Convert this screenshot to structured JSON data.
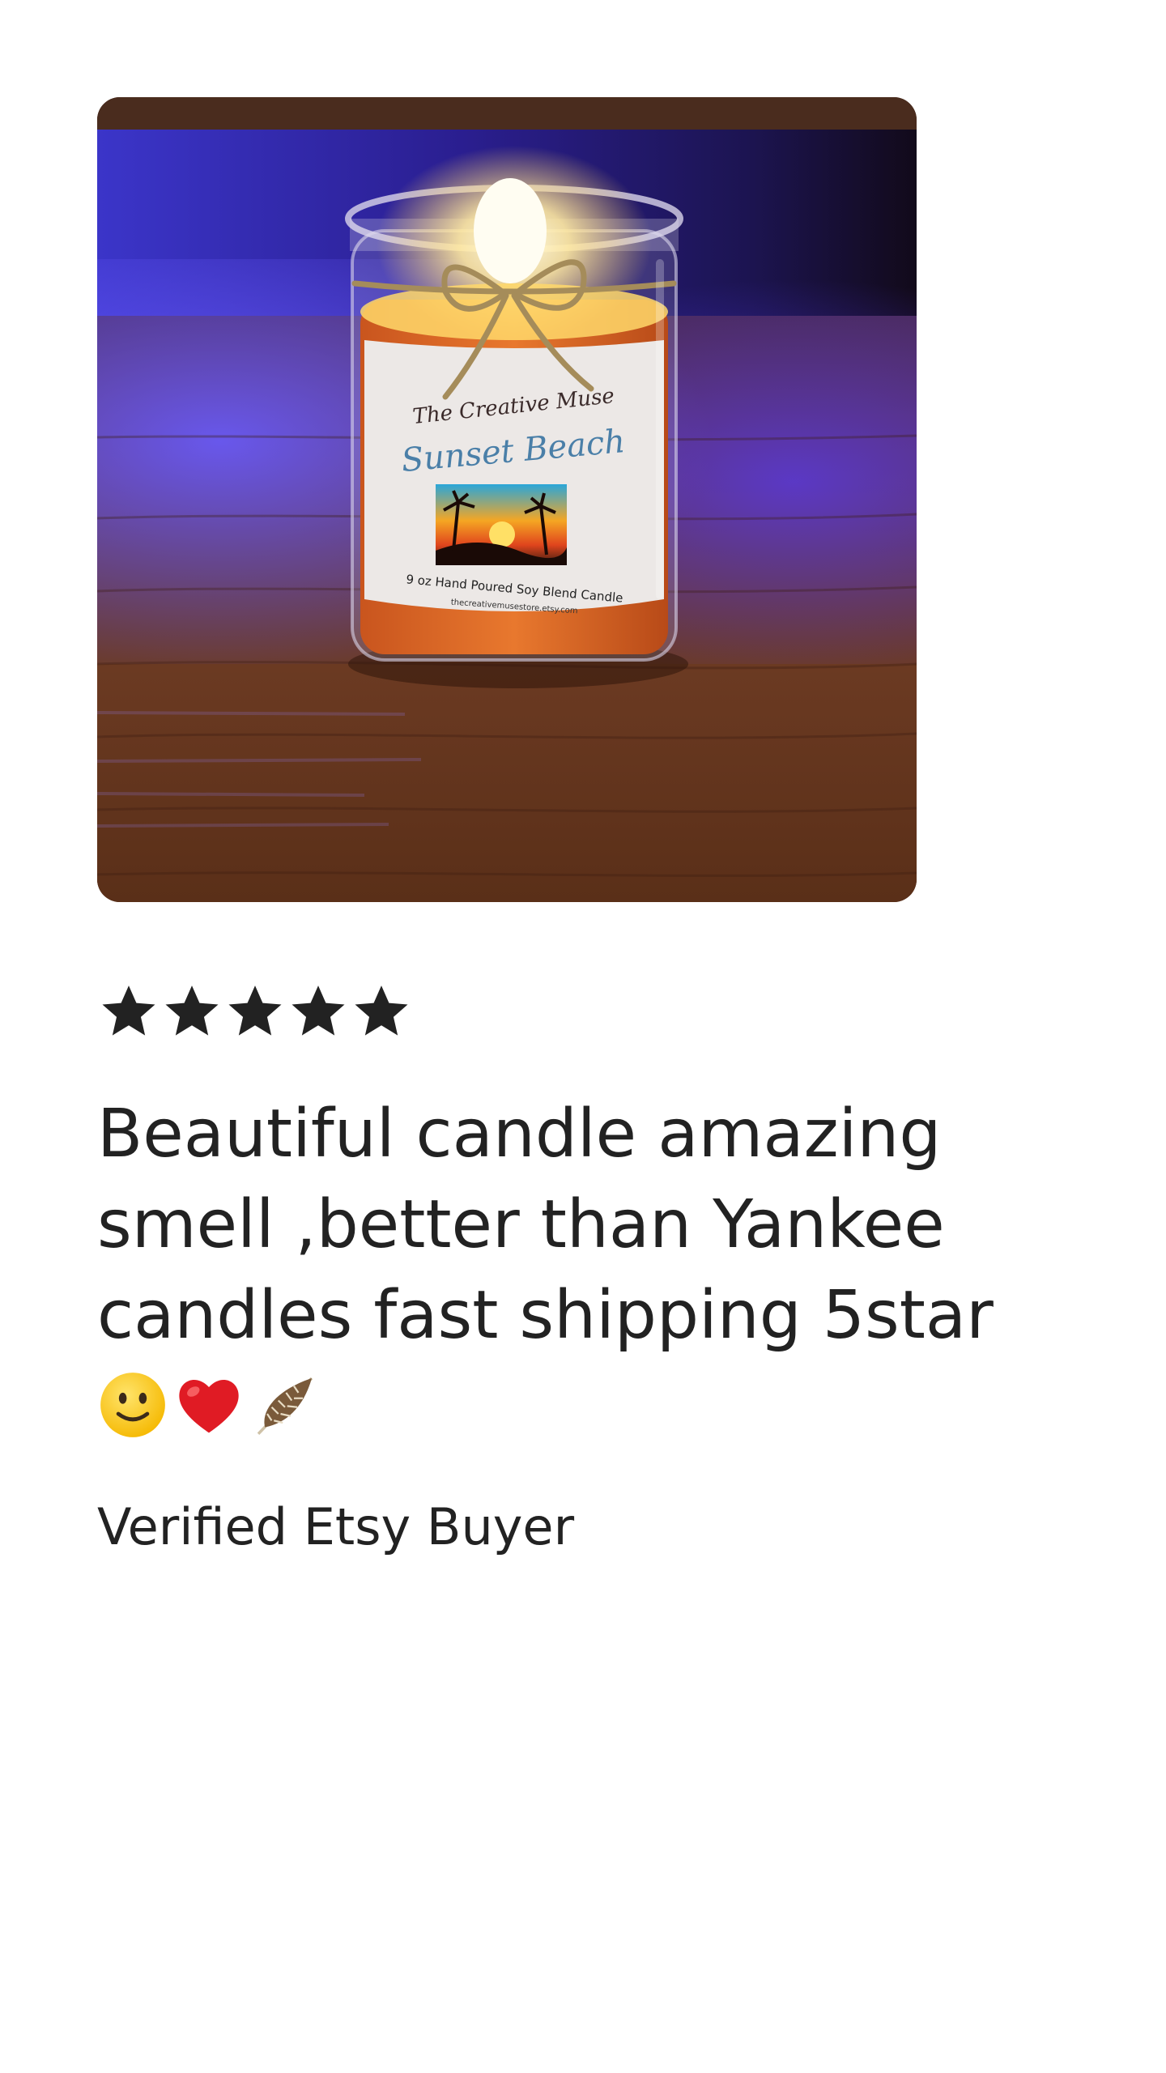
{
  "review": {
    "rating": 5,
    "rating_max": 5,
    "text": "Beautiful candle amazing smell ,better than Yankee candles fast shipping 5star",
    "emojis": [
      "slightly-smiling-face-icon",
      "red-heart-icon",
      "feather-icon"
    ],
    "reviewer": "Verified Etsy Buyer"
  },
  "photo": {
    "label_brand": "The Creative Muse",
    "label_scent": "Sunset Beach",
    "label_desc": "9 oz Hand Poured Soy Blend Candle",
    "label_url": "thecreativemusestore.etsy.com"
  },
  "colors": {
    "text": "#222222",
    "star": "#222222",
    "background": "#ffffff"
  }
}
